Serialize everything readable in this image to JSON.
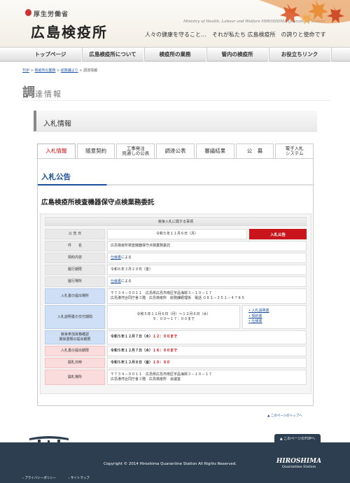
{
  "header": {
    "ministry": "厚生労働省",
    "site_name": "広島検疫所",
    "en_title": "Ministry of Health, Labour and Welfare HIROSHIMA Quarantine Station",
    "tagline": "人々の健康を守ること…　それが私たち 広島検疫所　の誇りと使命です"
  },
  "gnav": [
    "トップページ",
    "広島検疫所について",
    "検疫所の業務",
    "管内の検疫所",
    "お役立ちリンク"
  ],
  "breadcrumb": {
    "items": [
      "TOP",
      "検疫所の業務",
      "総務課より"
    ],
    "current": "調達情報",
    "sep": " > "
  },
  "page_heading": {
    "big": "調",
    "rest": "達情報"
  },
  "section_title": "入札情報",
  "tabs": [
    {
      "label": "入札情報",
      "active": true
    },
    {
      "label": "随意契約"
    },
    {
      "label": "工事発注\n見通しの公表"
    },
    {
      "label": "調達公表"
    },
    {
      "label": "審議結果"
    },
    {
      "label": "公　募"
    },
    {
      "label": "電子入札\nシステム"
    }
  ],
  "notice": {
    "title": "入札公告",
    "case_title": "広島検疫所検査機器保守点検業務委託",
    "info_head": "競争入札に関する事項",
    "rows": {
      "announce_date": {
        "label": "公 告 日",
        "value": "令和５年１１月６日（月）",
        "badge": "入札公告"
      },
      "subject": {
        "label": "件　　名",
        "value": "広島検疫所検査機器保守点検業務委託"
      },
      "content": {
        "label": "契約内容",
        "link": "仕様書",
        "suffix": "による"
      },
      "period": {
        "label": "履行期限",
        "value": "令和６年３月２９日（金）"
      },
      "place": {
        "label": "履行場所",
        "link": "仕様書",
        "suffix": "による"
      },
      "submit_to": {
        "label": "入札書の提出場所",
        "line1": "〒７３４－００１１　広島県広島市南区宇品海岸３－１０－１７",
        "line2": "広島港湾合同庁舎３階　広島検疫所　総務課経理係　電話 ０８２－２５１－４７８５"
      },
      "distribution": {
        "label": "入札説明書の交付期間",
        "line1": "令和５年１１月６日（月）～１２月６日（水）",
        "line2": "９：００～１７：００まで",
        "links": [
          "入札説明書",
          "契約書",
          "仕様書"
        ]
      },
      "docs_deadline": {
        "label": "競争参加資格確認\n関係書類の提出期限",
        "date": "令和５年１２月７日（木）",
        "time": "１２：００まで"
      },
      "bid_deadline": {
        "label": "入札書の提出期限",
        "date": "令和５年１２月７日（木）",
        "time": "１６：００まで"
      },
      "open_date": {
        "label": "開札日時",
        "date": "令和５年１２月８日（金）",
        "time": "１０：００"
      },
      "open_place": {
        "label": "開札場所",
        "line1": "〒７３４－００１１　広島県広島市南区宇品海岸３－１０－１７",
        "line2": "広島港湾合同庁舎３階　広島検疫所　会議室"
      }
    }
  },
  "to_top_small": "▲ このページのトップへ",
  "footer": {
    "to_top": "▲ このページのTOPへ",
    "copyright": "Copyright © 2014 Hiroshima Quarantine Station All Rights Reserved.",
    "logo_line1": "HIROSHIMA",
    "logo_line2": "Quarantine Station",
    "links": [
      "プライバシーポリシー",
      "サイトマップ"
    ]
  },
  "colors": {
    "accent_red": "#c8141a",
    "blue": "#1a4e9c",
    "footer": "#2c3e4f"
  }
}
